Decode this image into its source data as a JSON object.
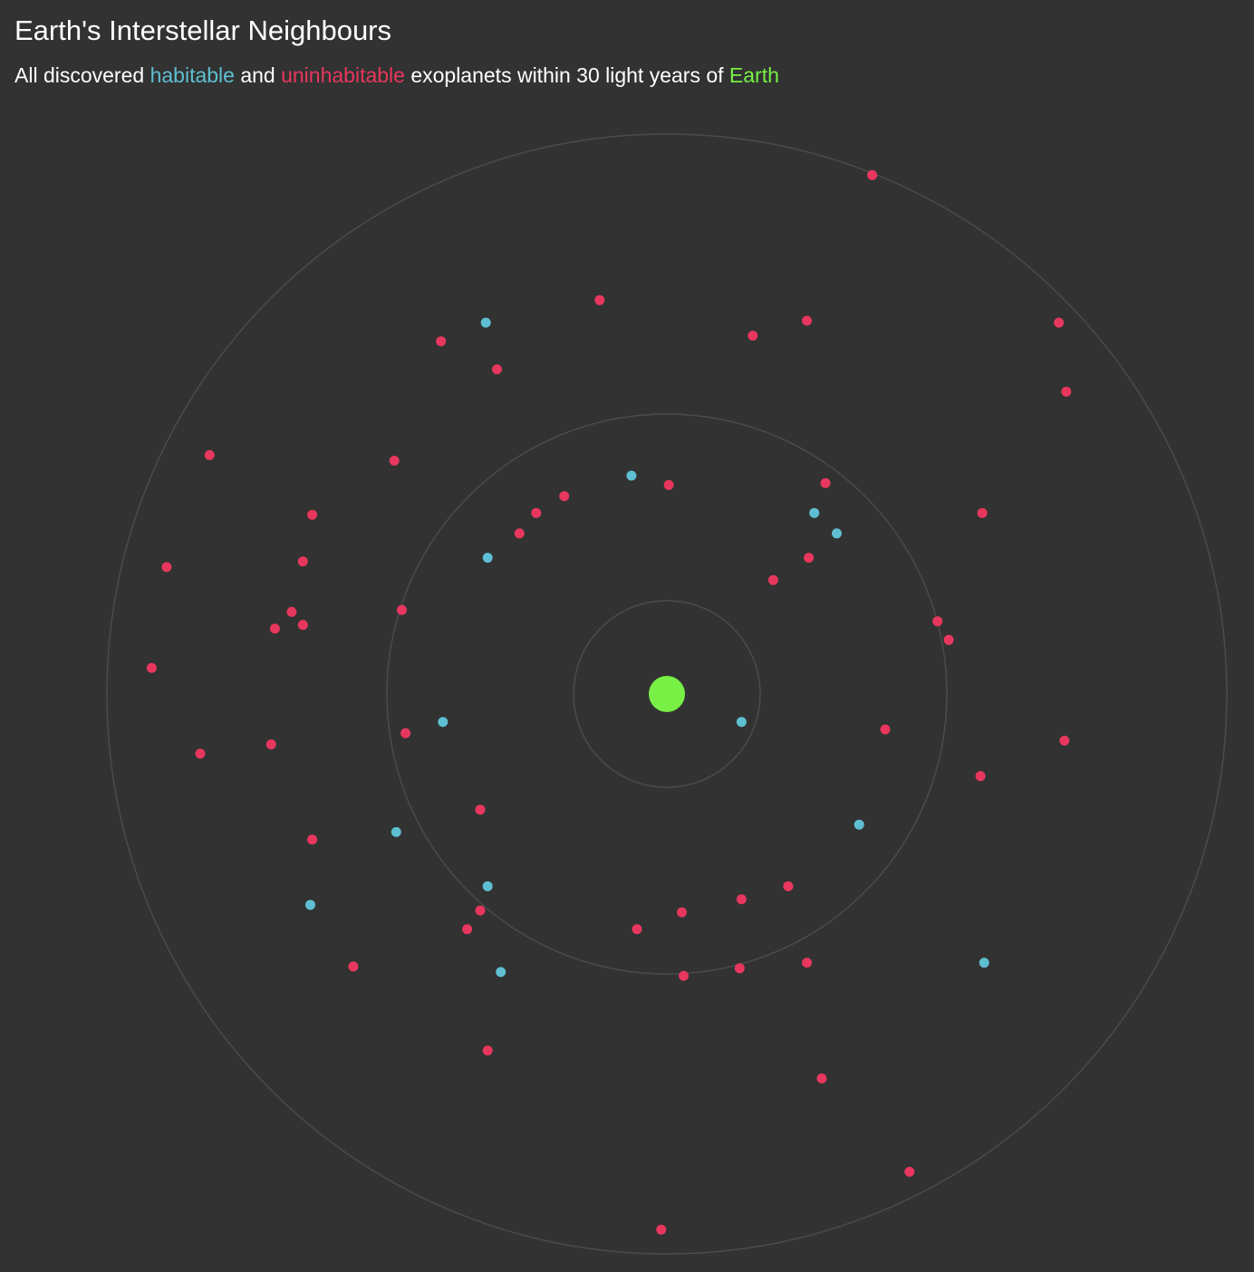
{
  "header": {
    "title": "Earth's Interstellar Neighbours",
    "subtitle_prefix": "All discovered ",
    "subtitle_habitable": "habitable",
    "subtitle_and": " and ",
    "subtitle_uninhabitable": "uninhabitable",
    "subtitle_mid": " exoplanets within 30 light years of ",
    "subtitle_earth": "Earth"
  },
  "colors": {
    "background": "#313231",
    "habitable": "#5fbfd2",
    "uninhabitable": "#e8375e",
    "earth": "#78f046",
    "rings": "#4a4b4a"
  },
  "chart_data": {
    "type": "scatter",
    "title": "Earth's Interstellar Neighbours",
    "subtitle": "All discovered habitable and uninhabitable exoplanets within 30 light years of Earth",
    "coordinate_system": "polar, Earth at origin, distance in light years",
    "max_distance_ly": 30,
    "rings_ly": [
      5,
      15,
      30
    ],
    "center": {
      "name": "Earth"
    },
    "series": [
      {
        "name": "habitable",
        "points": [
          {
            "x": -9.7,
            "y": 19.9
          },
          {
            "x": -1.9,
            "y": 11.7
          },
          {
            "x": 7.9,
            "y": 9.7
          },
          {
            "x": 9.1,
            "y": 8.6
          },
          {
            "x": -9.6,
            "y": 7.3
          },
          {
            "x": -12.0,
            "y": -1.5
          },
          {
            "x": 4.0,
            "y": -1.5
          },
          {
            "x": 10.3,
            "y": -7.0
          },
          {
            "x": -14.5,
            "y": -7.4
          },
          {
            "x": -9.6,
            "y": -10.3
          },
          {
            "x": -19.1,
            "y": -11.3
          },
          {
            "x": 17.0,
            "y": -14.4
          },
          {
            "x": -8.9,
            "y": -14.9
          }
        ]
      },
      {
        "name": "uninhabitable",
        "points": [
          {
            "x": 11.0,
            "y": 27.8
          },
          {
            "x": -3.6,
            "y": 21.1
          },
          {
            "x": 7.5,
            "y": 20.0
          },
          {
            "x": 4.6,
            "y": 19.2
          },
          {
            "x": 21.0,
            "y": 19.9
          },
          {
            "x": -12.1,
            "y": 18.9
          },
          {
            "x": -9.1,
            "y": 17.4
          },
          {
            "x": 21.4,
            "y": 16.2
          },
          {
            "x": -24.5,
            "y": 12.8
          },
          {
            "x": -14.6,
            "y": 12.5
          },
          {
            "x": 0.1,
            "y": 11.2
          },
          {
            "x": 8.5,
            "y": 11.3
          },
          {
            "x": -5.5,
            "y": 10.6
          },
          {
            "x": -7.0,
            "y": 9.7
          },
          {
            "x": 16.9,
            "y": 9.7
          },
          {
            "x": -19.0,
            "y": 9.6
          },
          {
            "x": -7.9,
            "y": 8.6
          },
          {
            "x": -26.8,
            "y": 6.8
          },
          {
            "x": -19.5,
            "y": 7.1
          },
          {
            "x": 7.6,
            "y": 7.3
          },
          {
            "x": 5.7,
            "y": 6.1
          },
          {
            "x": -14.2,
            "y": 4.5
          },
          {
            "x": -20.1,
            "y": 4.4
          },
          {
            "x": -19.5,
            "y": 3.7
          },
          {
            "x": -21.0,
            "y": 3.5
          },
          {
            "x": 14.5,
            "y": 3.9
          },
          {
            "x": 15.1,
            "y": 2.9
          },
          {
            "x": -27.6,
            "y": 1.4
          },
          {
            "x": -14.0,
            "y": -2.1
          },
          {
            "x": 11.7,
            "y": -1.9
          },
          {
            "x": 21.3,
            "y": -2.5
          },
          {
            "x": -25.0,
            "y": -3.2
          },
          {
            "x": -21.2,
            "y": -2.7
          },
          {
            "x": 16.8,
            "y": -4.4
          },
          {
            "x": -10.0,
            "y": -6.2
          },
          {
            "x": 6.5,
            "y": -10.3
          },
          {
            "x": 4.0,
            "y": -11.0
          },
          {
            "x": 0.8,
            "y": -11.7
          },
          {
            "x": -19.0,
            "y": -7.8
          },
          {
            "x": -10.0,
            "y": -11.6
          },
          {
            "x": -10.7,
            "y": -12.6
          },
          {
            "x": -1.6,
            "y": -12.6
          },
          {
            "x": 7.5,
            "y": -14.4
          },
          {
            "x": 3.9,
            "y": -14.7
          },
          {
            "x": 0.9,
            "y": -15.1
          },
          {
            "x": -16.8,
            "y": -14.6
          },
          {
            "x": -9.6,
            "y": -19.1
          },
          {
            "x": 8.3,
            "y": -20.6
          },
          {
            "x": 13.0,
            "y": -25.6
          },
          {
            "x": -0.3,
            "y": -28.7
          }
        ]
      }
    ]
  }
}
